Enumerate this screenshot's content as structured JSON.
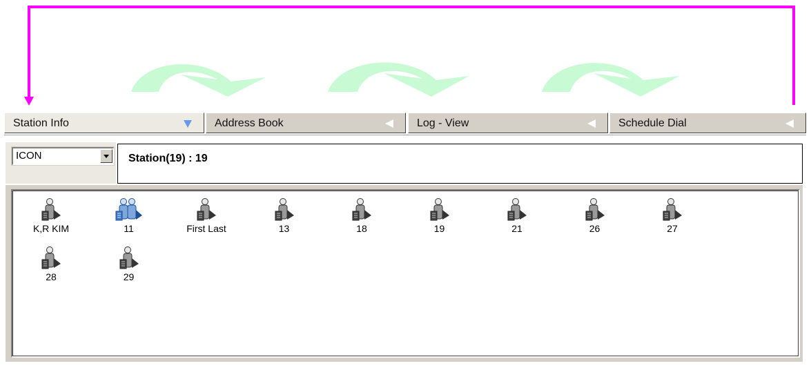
{
  "colors": {
    "flow_arrow": "#ff00ff",
    "cycle_arrow": "#c8fbd4",
    "tab_bg": "#d4d0c8",
    "active_indicator": "#6699ee"
  },
  "tabs": [
    {
      "label": "Station Info",
      "icon": "triangle-down-icon",
      "active": true
    },
    {
      "label": "Address Book",
      "icon": "triangle-left-icon",
      "active": false
    },
    {
      "label": "Log - View",
      "icon": "triangle-left-icon",
      "active": false
    },
    {
      "label": "Schedule Dial",
      "icon": "triangle-left-icon",
      "active": false
    }
  ],
  "view_select": {
    "value": "ICON"
  },
  "station_info": {
    "text": "Station(19) :  19"
  },
  "stations": [
    {
      "name": "K,R KIM",
      "icon": "single-station-icon"
    },
    {
      "name": "11",
      "icon": "group-station-icon"
    },
    {
      "name": "First Last",
      "icon": "single-station-icon"
    },
    {
      "name": "13",
      "icon": "single-station-icon"
    },
    {
      "name": "18",
      "icon": "single-station-icon"
    },
    {
      "name": "19",
      "icon": "single-station-icon"
    },
    {
      "name": "21",
      "icon": "single-station-icon"
    },
    {
      "name": "26",
      "icon": "single-station-icon"
    },
    {
      "name": "27",
      "icon": "single-station-icon"
    },
    {
      "name": "28",
      "icon": "single-station-icon"
    },
    {
      "name": "29",
      "icon": "single-station-icon"
    }
  ]
}
